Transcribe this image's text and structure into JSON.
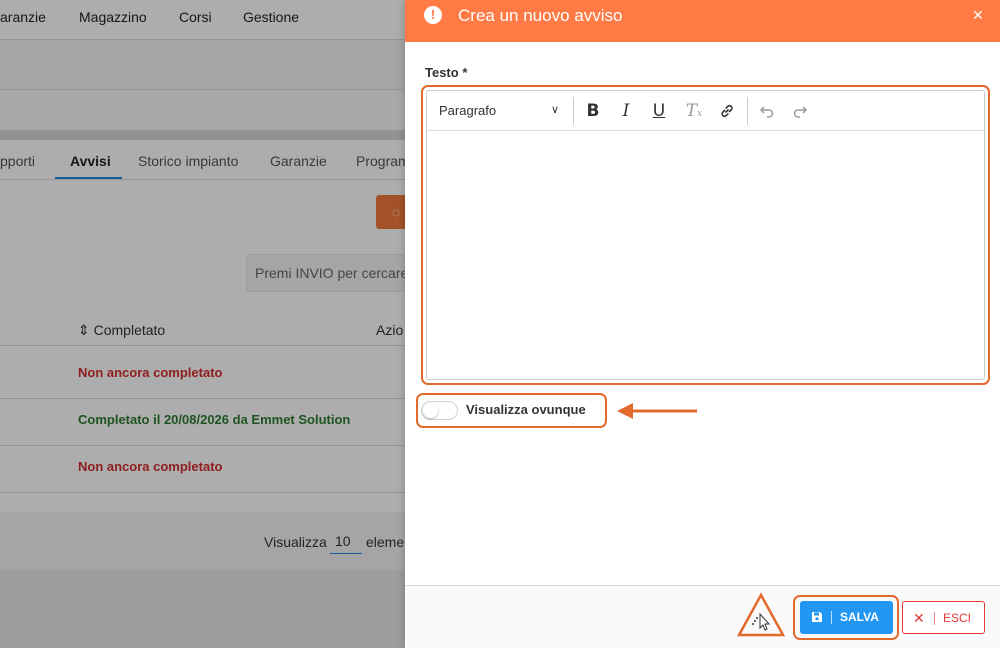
{
  "background": {
    "nav": [
      "aranzie",
      "Magazzino",
      "Corsi",
      "Gestione"
    ],
    "tabs": [
      "pporti",
      "Avvisi",
      "Storico impianto",
      "Garanzie",
      "Program"
    ],
    "active_tab": "Avvisi",
    "search_placeholder": "Premi INVIO per cercare",
    "columns": [
      "Completato",
      "Azio"
    ],
    "rows": [
      {
        "status": "Non ancora completato",
        "kind": "pending"
      },
      {
        "status": "Completato il 20/08/2026 da Emmet Solution",
        "kind": "done"
      },
      {
        "status": "Non ancora completato",
        "kind": "pending"
      }
    ],
    "footer": {
      "show_label": "Visualizza",
      "page_size": "10",
      "elements_label": "elemen"
    }
  },
  "drawer": {
    "title": "Crea un nuovo avviso",
    "header_color": "#ff7a45",
    "text_field_label": "Testo *",
    "editor": {
      "paragraph_style": "Paragrafo",
      "tools": [
        "bold-icon",
        "italic-icon",
        "underline-icon",
        "clear-format-icon",
        "link-icon",
        "undo-icon",
        "redo-icon"
      ],
      "content": ""
    },
    "toggle": {
      "label": "Visualizza ovunque",
      "on": false
    },
    "buttons": {
      "save": "SALVA",
      "exit": "ESCI"
    }
  },
  "colors": {
    "accent": "#e36a2d",
    "save": "#2196f3",
    "exit": "#e53935",
    "pending": "#d32f2f",
    "done": "#2e7d32"
  }
}
